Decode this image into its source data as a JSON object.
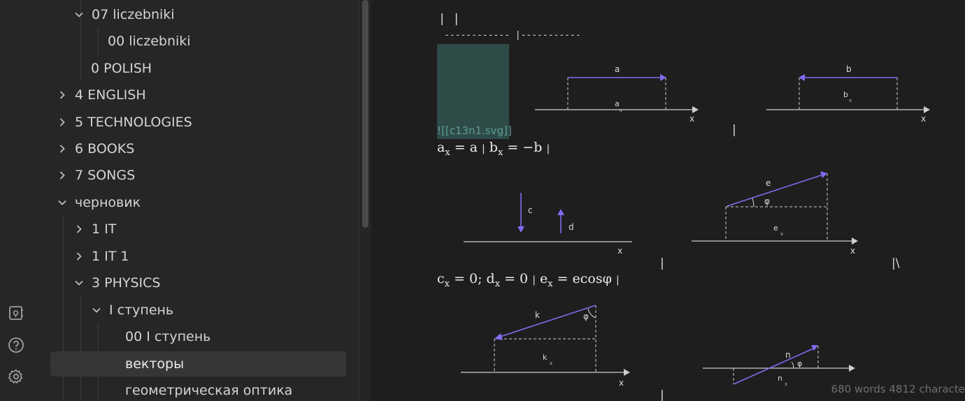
{
  "sidebar": {
    "items": [
      {
        "label": "07 liczebniki"
      },
      {
        "label": "00 liczebniki"
      },
      {
        "label": "0 POLISH"
      },
      {
        "label": "4 ENGLISH"
      },
      {
        "label": "5 TECHNOLOGIES"
      },
      {
        "label": "6 BOOKS"
      },
      {
        "label": "7 SONGS"
      },
      {
        "label": "черновик"
      },
      {
        "label": "1 IT"
      },
      {
        "label": "1 IT 1"
      },
      {
        "label": "3 PHYSICS"
      },
      {
        "label": "I ступень"
      },
      {
        "label": "00 I ступень"
      },
      {
        "label": "векторы"
      },
      {
        "label": "геометрическая оптика"
      }
    ]
  },
  "ribbon": {
    "icons": [
      "vault-switcher-icon",
      "help-icon",
      "settings-icon"
    ]
  },
  "editor": {
    "table_header": "| |",
    "table_divider": "------------ |-----------",
    "embed_link": "![[c13n1.svg]]",
    "pipe_1": "|",
    "pipe_2": "|",
    "pipe_3": "|\\",
    "pipe_4": "|",
    "math_1": {
      "a": "a",
      "x": "x",
      "eq1": " = a ",
      "sep": "|",
      "b": " b",
      "eq2": " = −b ",
      "end": "|"
    },
    "math_2": {
      "c": "c",
      "x": "x",
      "eq1": " = 0; d",
      "eq2": " = 0 ",
      "sep": "|",
      "e": " e",
      "eq3": " = ecosφ ",
      "end": "|"
    },
    "figures": {
      "fig1": {
        "vec": "a",
        "proj": "a",
        "sub": "x",
        "axis": "x"
      },
      "fig2": {
        "vec": "b",
        "proj": "b",
        "sub": "x",
        "axis": "x"
      },
      "fig3": {
        "vec1": "c",
        "vec2": "d",
        "axis": "x"
      },
      "fig4": {
        "vec": "e",
        "angle": "φ",
        "proj": "e",
        "sub": "x",
        "axis": "x"
      },
      "fig5": {
        "vec": "k",
        "angle": "φ",
        "proj": "k",
        "sub": "x",
        "axis": "x"
      },
      "fig6": {
        "vec": "n",
        "angle": "φ",
        "proj": "n",
        "sub": "x",
        "axis": "x"
      }
    }
  },
  "status": {
    "text": "680 words 4812 characte"
  },
  "colors": {
    "accent_vector": "#7f6df2",
    "embed_bg": "#2f4b48",
    "active_row": "#363636"
  }
}
